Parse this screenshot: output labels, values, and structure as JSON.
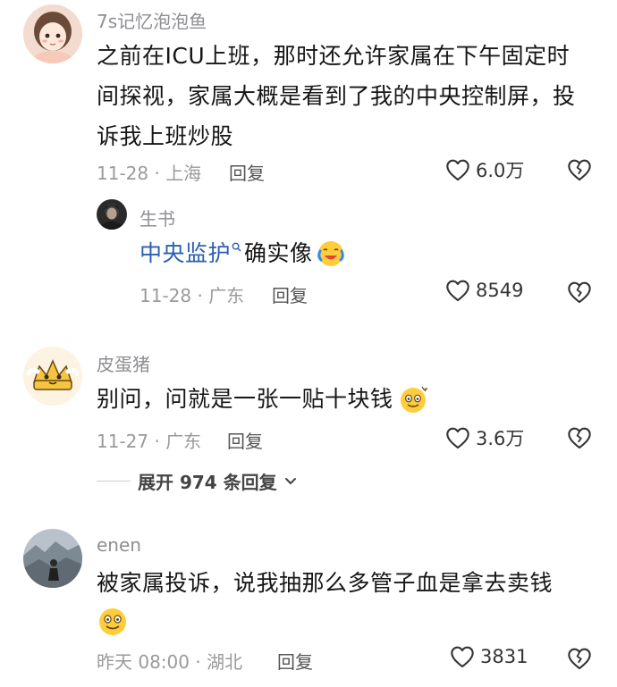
{
  "comments": [
    {
      "username": "7s记忆泡泡鱼",
      "text_line1": "之前在ICU上班，那时还允许家属在下午固定时",
      "text_line2": "间探视，家属大概是看到了我的中央控制屏，投",
      "text_line3": "诉我上班炒股",
      "meta": "11-28 · 上海",
      "reply_label": "回复",
      "likes": "6.0万",
      "reply": {
        "username": "生书",
        "link_text": "中央监护",
        "text": "确实像",
        "emoji": "laughing-crying-emoji",
        "meta": "11-28 · 广东",
        "reply_label": "回复",
        "likes": "8549"
      }
    },
    {
      "username": "皮蛋猪",
      "text": "别问，问就是一张一贴十块钱",
      "emoji": "dizzy-smile-emoji",
      "meta": "11-27 · 广东",
      "reply_label": "回复",
      "likes": "3.6万",
      "expand_label": "展开 974 条回复"
    },
    {
      "username": "enen",
      "text": "被家属投诉，说我抽那么多管子血是拿去卖钱",
      "emoji": "smile-emoji",
      "meta": "昨天 08:00 · 湖北",
      "reply_label": "回复",
      "likes": "3831"
    }
  ],
  "icons": {
    "like": "heart-outline-icon",
    "dislike": "broken-heart-icon",
    "search": "search-icon",
    "expand": "chevron-down-icon"
  },
  "colors": {
    "link": "#2b5fb0",
    "muted": "#9a9a9a",
    "text": "#161616"
  }
}
